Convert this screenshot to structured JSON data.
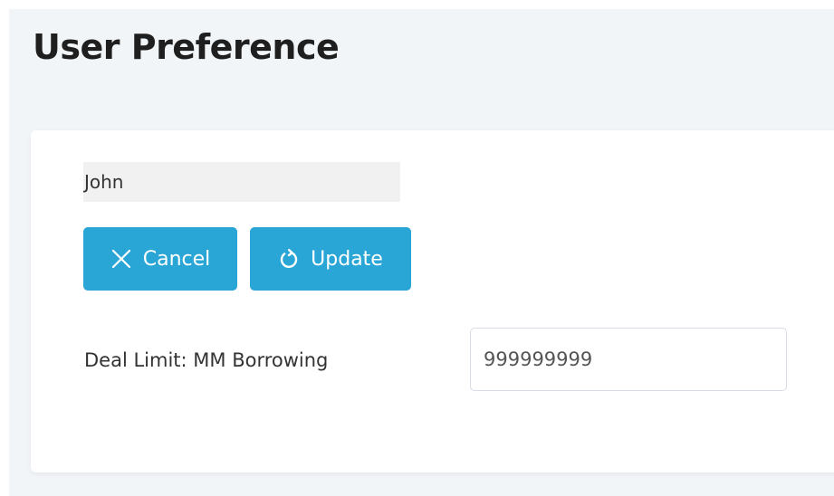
{
  "page": {
    "title": "User Preference"
  },
  "form": {
    "user_name": "John",
    "cancel_label": "Cancel",
    "update_label": "Update",
    "deal_limit_label": "Deal Limit: MM Borrowing",
    "deal_limit_value": "999999999"
  },
  "icons": {
    "cancel": "close-icon",
    "update": "refresh-icon"
  },
  "colors": {
    "button_background": "#2aa6d6",
    "page_background": "#f2f5f8",
    "card_background": "#ffffff"
  }
}
